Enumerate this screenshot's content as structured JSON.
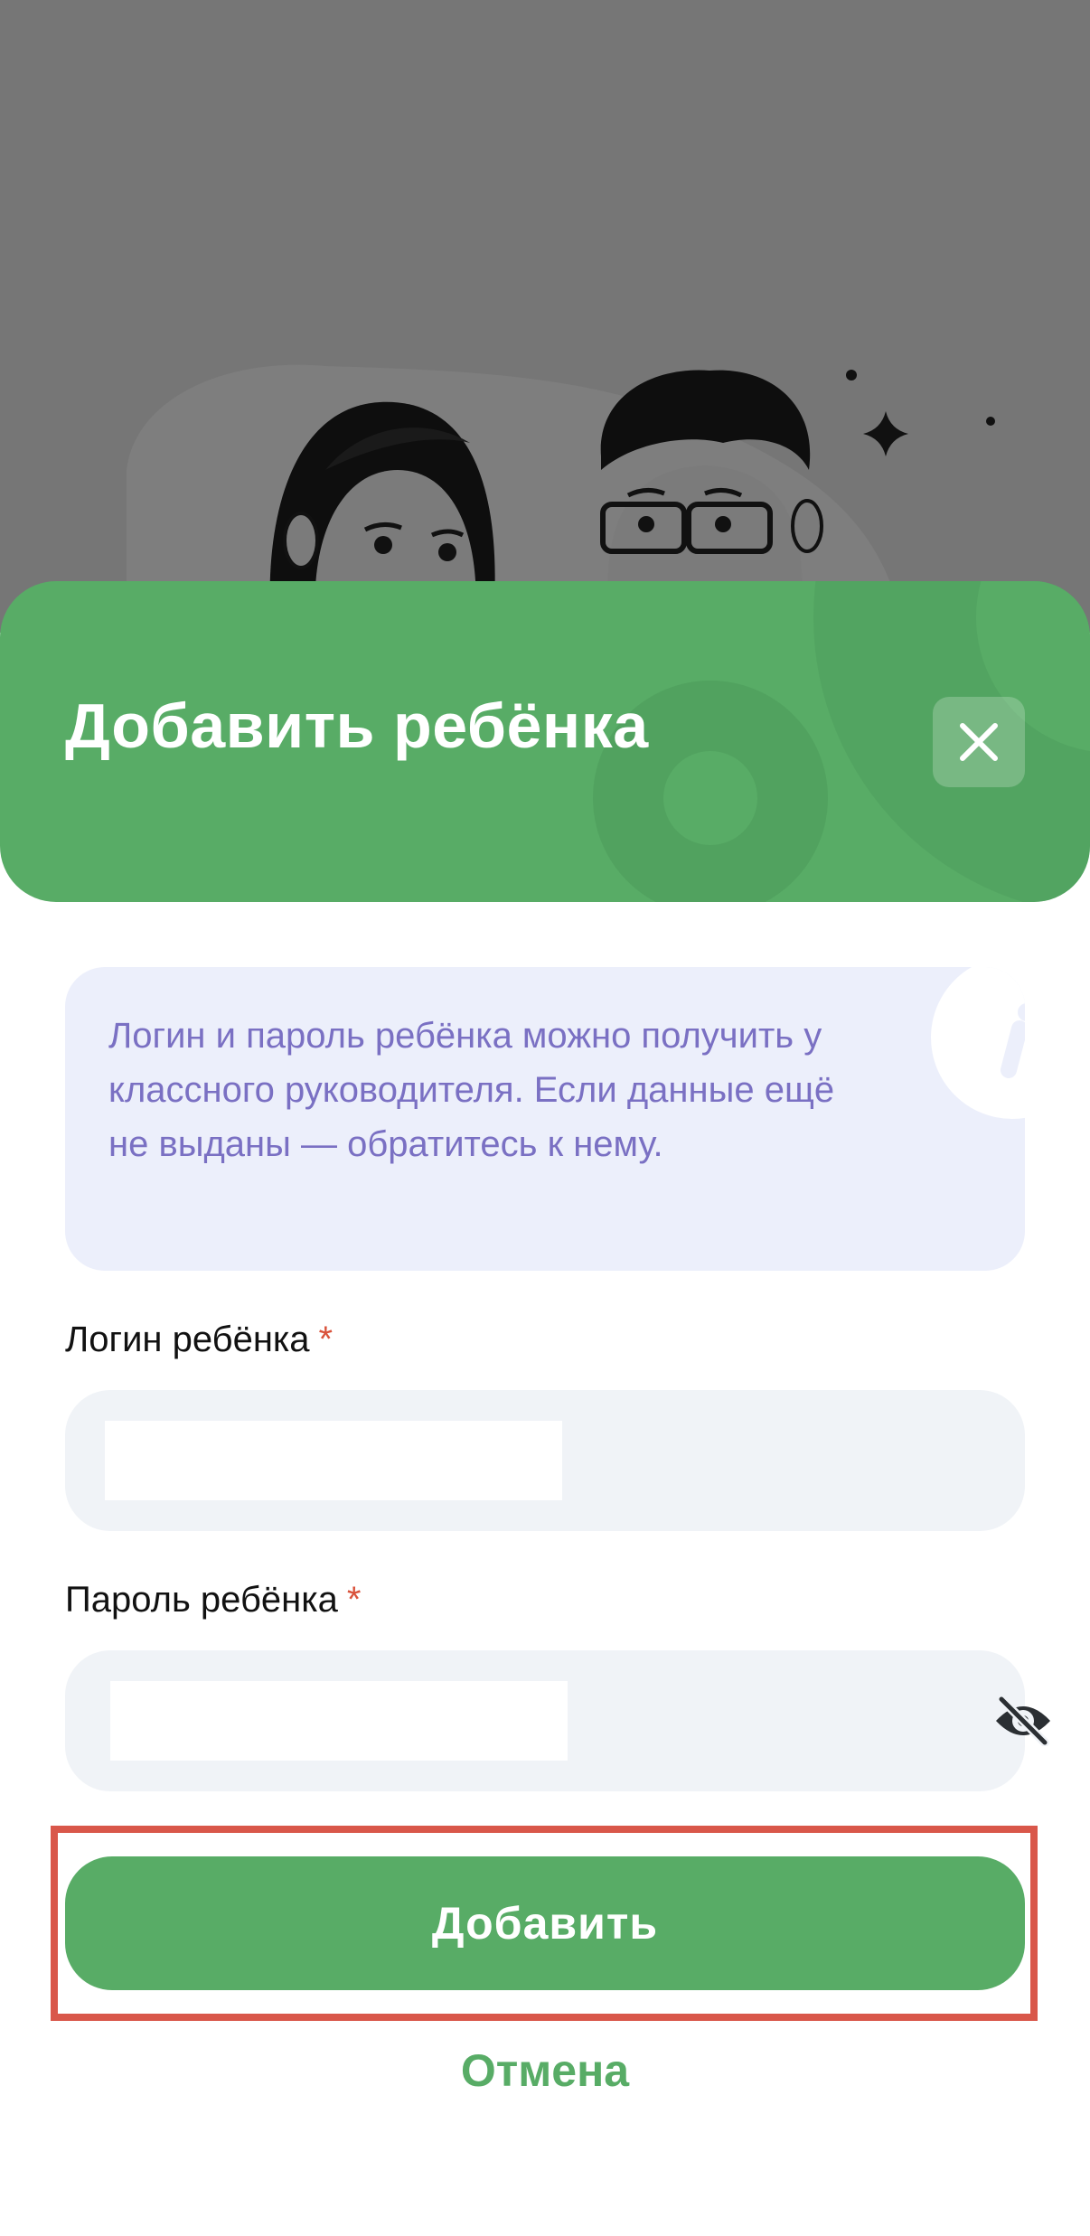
{
  "modal": {
    "title": "Добавить ребёнка",
    "close_icon": "close-icon"
  },
  "info": {
    "text": "Логин и пароль ребёнка можно получить у классного руководителя. Если данные ещё не выданы — обратитесь к нему.",
    "icon": "info-icon"
  },
  "login_field": {
    "label": "Логин ребёнка",
    "required_mark": "*",
    "value": ""
  },
  "password_field": {
    "label": "Пароль ребёнка",
    "required_mark": "*",
    "value": "",
    "toggle_icon": "eye-off-icon"
  },
  "actions": {
    "submit_label": "Добавить",
    "cancel_label": "Отмена"
  },
  "colors": {
    "accent": "#58ac66",
    "info_text": "#7a70c3",
    "info_bg": "#eceffb",
    "required": "#d9523b",
    "highlight_border": "#d9574a",
    "backdrop": "#767676"
  }
}
